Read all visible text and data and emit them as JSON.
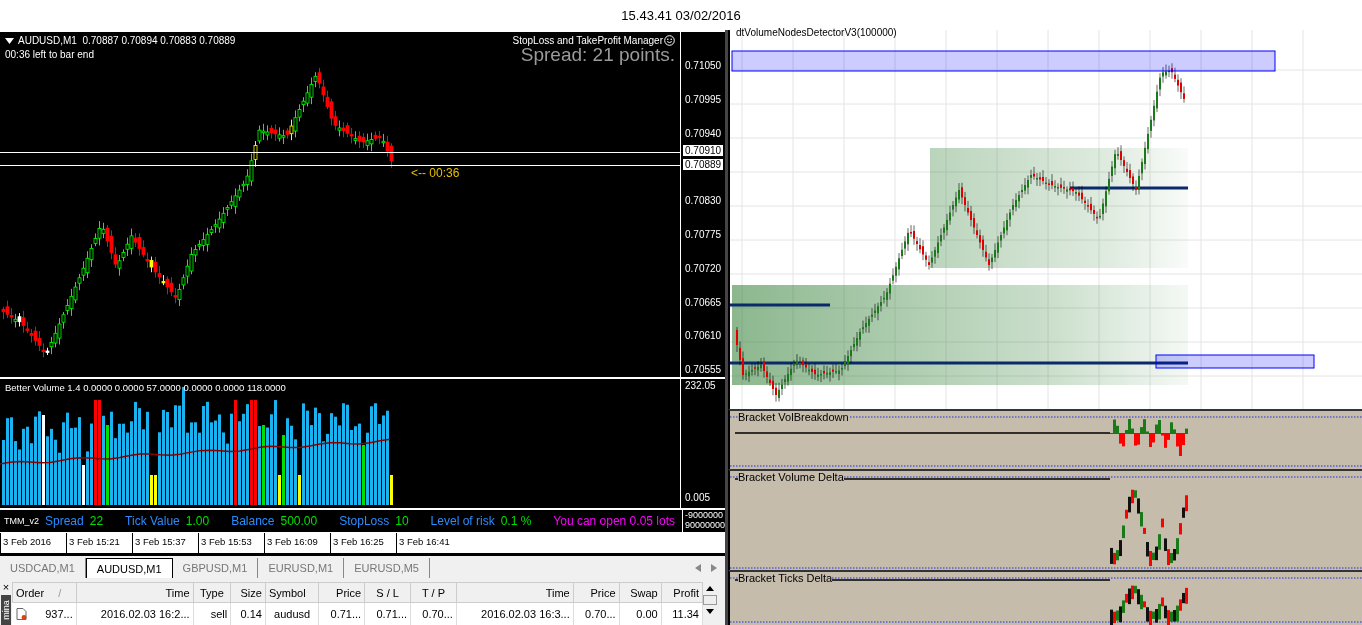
{
  "clock": "15.43.41 03/02/2016",
  "main_chart": {
    "header": "AUDUSD,M1  0.70887 0.70894 0.70883 0.70889",
    "timer": "00:36 left to bar end",
    "manager_label": "StopLoss and TakeProfit Manager",
    "spread_text": "Spread: 21 points.",
    "countdown": "<-- 00:36",
    "price_ticks": [
      "0.71050",
      "0.70995",
      "0.70940",
      "0.70830",
      "0.70775",
      "0.70720",
      "0.70665",
      "0.70610",
      "0.70555"
    ],
    "line_labels": [
      "0.70910",
      "0.70889"
    ]
  },
  "volume_pane": {
    "title": "Better Volume 1.4 0.0000 0.0000 57.0000 0.0000 0.0000 118.0000",
    "max_label": "232.05",
    "min_label": "0.005"
  },
  "info_pane": {
    "title": "TMM_v2",
    "items": [
      {
        "label": "Spread",
        "value": "22"
      },
      {
        "label": "Tick Value",
        "value": "1.00"
      },
      {
        "label": "Balance",
        "value": "500.00"
      },
      {
        "label": "StopLoss",
        "value": "10"
      },
      {
        "label": "Level of risk",
        "value": "0.1 %"
      }
    ],
    "message": "You can open 0.05 lots",
    "scale": [
      "-9000000",
      "90000000"
    ]
  },
  "time_axis": [
    "3 Feb 2016",
    "3 Feb 15:21",
    "3 Feb 15:37",
    "3 Feb 15:53",
    "3 Feb 16:09",
    "3 Feb 16:25",
    "3 Feb 16:41"
  ],
  "chart_tabs": [
    {
      "label": "USDCAD,M1",
      "selected": false
    },
    {
      "label": "AUDUSD,M1",
      "selected": true
    },
    {
      "label": "GBPUSD,M1",
      "selected": false
    },
    {
      "label": "EURUSD,M1",
      "selected": false
    },
    {
      "label": "EURUSD,M5",
      "selected": false
    }
  ],
  "terminal": {
    "side_label": "mina",
    "close": "×",
    "sort_mark": "/",
    "columns": [
      "Order",
      "Time",
      "Type",
      "Size",
      "Symbol",
      "Price",
      "S / L",
      "T / P",
      "Time",
      "Price",
      "Swap",
      "Profit"
    ],
    "rows": [
      [
        "937...",
        "2016.02.03 16:2...",
        "sell",
        "0.14",
        "audusd",
        "0.71...",
        "0.71...",
        "0.70...",
        "2016.02.03 16:3...",
        "0.70...",
        "0.00",
        "11.34"
      ]
    ]
  },
  "right_chart": {
    "title": "dtVolumeNodesDetectorV3(100000)",
    "panes": [
      {
        "title": "Bracket VolBreakdown",
        "kind": "histogram"
      },
      {
        "title": "Bracket Volume Delta",
        "kind": "candles"
      },
      {
        "title": "Bracket Ticks Delta",
        "kind": "candles"
      }
    ]
  }
}
